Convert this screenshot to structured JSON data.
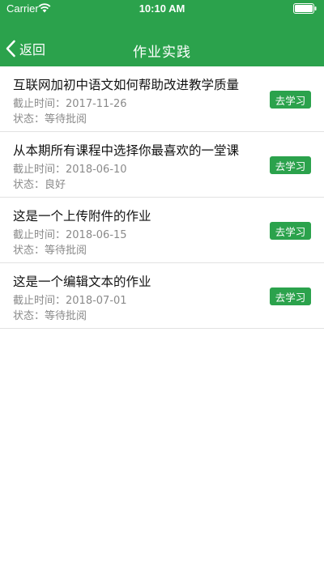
{
  "status_bar": {
    "carrier": "Carrier",
    "time": "10:10 AM"
  },
  "nav": {
    "back_label": "返回",
    "title": "作业实践"
  },
  "colors": {
    "brand_green": "#2ba24c",
    "muted_text": "#8a8a8a",
    "divider": "#e2e2e2"
  },
  "assignments": [
    {
      "title": "互联网加初中语文如何帮助改进教学质量",
      "deadline": "截止时间：2017-11-26",
      "status": "状态：等待批阅",
      "action": "去学习"
    },
    {
      "title": "从本期所有课程中选择你最喜欢的一堂课",
      "deadline": "截止时间：2018-06-10",
      "status": "状态：良好",
      "action": "去学习"
    },
    {
      "title": "这是一个上传附件的作业",
      "deadline": "截止时间：2018-06-15",
      "status": "状态：等待批阅",
      "action": "去学习"
    },
    {
      "title": "这是一个编辑文本的作业",
      "deadline": "截止时间：2018-07-01",
      "status": "状态：等待批阅",
      "action": "去学习"
    }
  ]
}
